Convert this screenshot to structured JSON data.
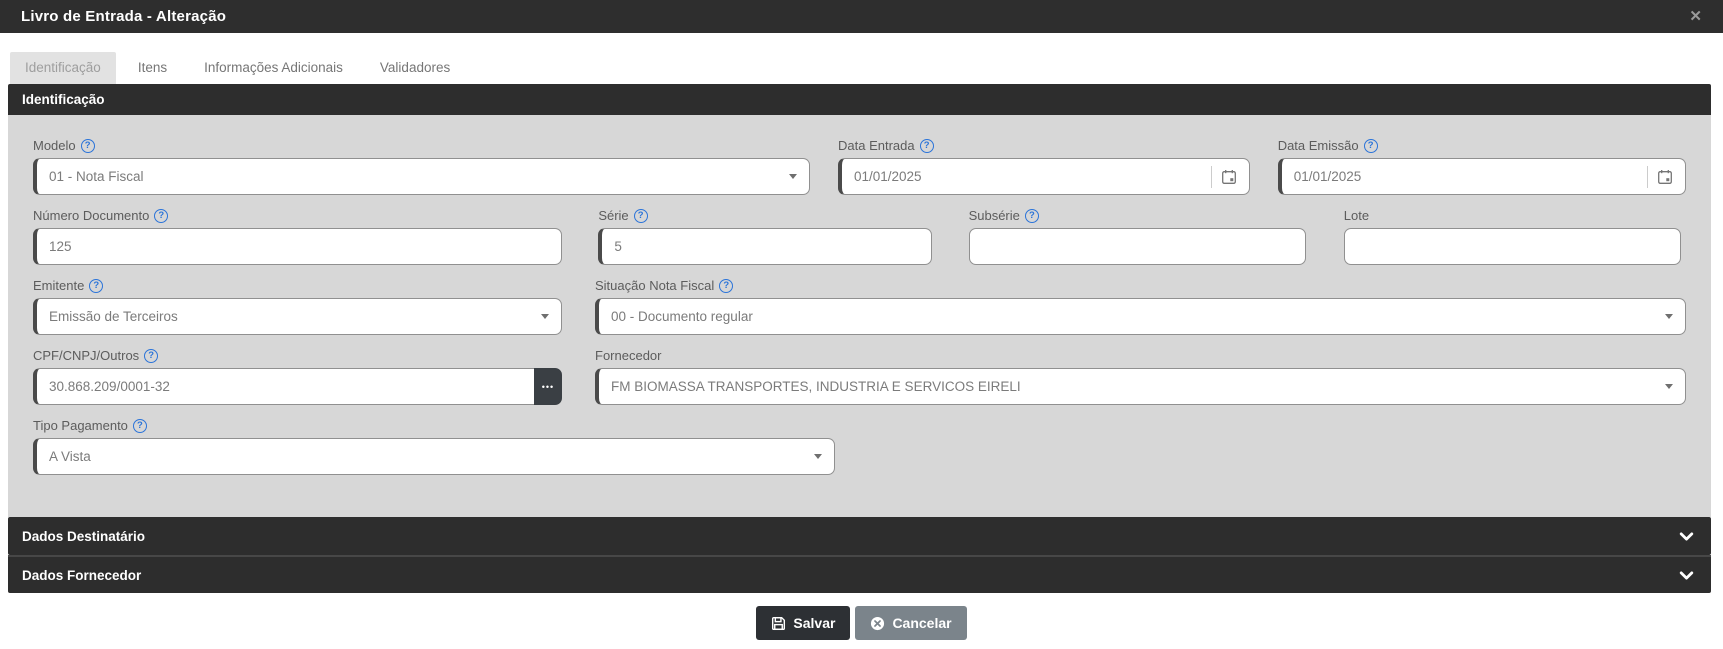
{
  "window": {
    "title": "Livro de Entrada - Alteração"
  },
  "glyphs": {
    "close": "✕",
    "help": "?",
    "ellipsis": "•••"
  },
  "tabs": [
    {
      "label": "Identificação",
      "active": true
    },
    {
      "label": "Itens",
      "active": false
    },
    {
      "label": "Informações Adicionais",
      "active": false
    },
    {
      "label": "Validadores",
      "active": false
    }
  ],
  "section_title": "Identificação",
  "fields": {
    "modelo": {
      "label": "Modelo",
      "value": "01 - Nota Fiscal"
    },
    "data_entrada": {
      "label": "Data Entrada",
      "value": "01/01/2025"
    },
    "data_emissao": {
      "label": "Data Emissão",
      "value": "01/01/2025"
    },
    "numero_documento": {
      "label": "Número Documento",
      "value": "125"
    },
    "serie": {
      "label": "Série",
      "value": "5"
    },
    "subserie": {
      "label": "Subsérie",
      "value": ""
    },
    "lote": {
      "label": "Lote",
      "value": ""
    },
    "emitente": {
      "label": "Emitente",
      "value": "Emissão de Terceiros"
    },
    "situacao_nota_fiscal": {
      "label": "Situação Nota Fiscal",
      "value": "00 - Documento regular"
    },
    "cpf_cnpj_outros": {
      "label": "CPF/CNPJ/Outros",
      "value": "30.868.209/0001-32"
    },
    "fornecedor": {
      "label": "Fornecedor",
      "value": "FM BIOMASSA TRANSPORTES, INDUSTRIA E SERVICOS EIRELI"
    },
    "tipo_pagamento": {
      "label": "Tipo Pagamento",
      "value": "A Vista"
    }
  },
  "accordions": [
    {
      "label": "Dados Destinatário"
    },
    {
      "label": "Dados Fornecedor"
    }
  ],
  "footer": {
    "save_label": "Salvar",
    "cancel_label": "Cancelar"
  },
  "colors": {
    "titlebar_bg": "#2e2e2e",
    "section_bg": "#2d2d2d",
    "form_bg": "#d7d7d7",
    "help_blue": "#2b74d9",
    "save_bg": "#2d3034",
    "cancel_bg": "#7b848b"
  }
}
